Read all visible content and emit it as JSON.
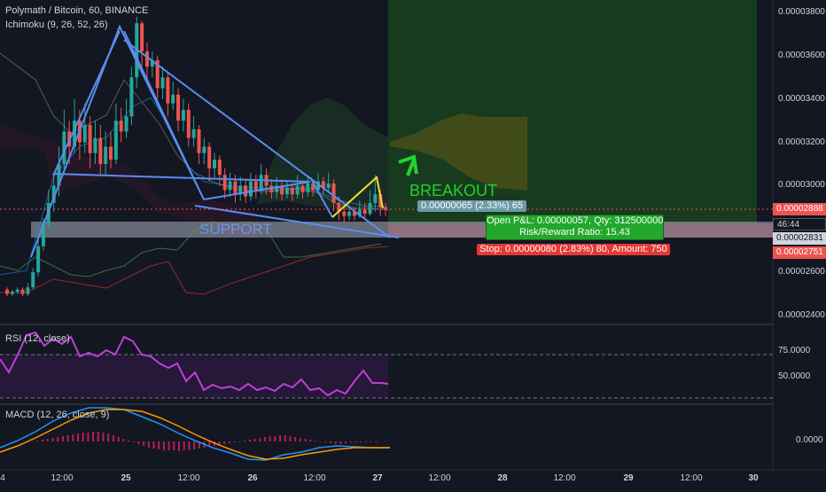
{
  "header": {
    "symbol_title": "Polymath / Bitcoin, 60, BINANCE",
    "indicator_ichimoku": "Ichimoku (9, 26, 52, 26)",
    "indicator_rsi": "RSI (12, close)",
    "indicator_macd": "MACD (12, 26, close, 9)"
  },
  "price_axis": {
    "ticks": [
      "0.00003800",
      "0.00003600",
      "0.00003400",
      "0.00003200",
      "0.00003000",
      "0.00002600",
      "0.00002400"
    ],
    "tick_values": [
      3.8e-05,
      3.6e-05,
      3.4e-05,
      3.2e-05,
      3e-05,
      2.6e-05,
      2.4e-05
    ],
    "current_price": "0.00002888",
    "countdown": "46:44",
    "entry_price": "0.00002831",
    "stop_price": "0.00002751"
  },
  "rsi_axis": {
    "ticks": [
      "75.0000",
      "50.0000"
    ],
    "tick_values": [
      75,
      50
    ],
    "upper_band": 70,
    "lower_band": 30
  },
  "macd_axis": {
    "ticks": [
      "0.0000"
    ],
    "tick_values": [
      0
    ]
  },
  "time_axis": {
    "labels": [
      "4",
      "12:00",
      "25",
      "12:00",
      "26",
      "12:00",
      "27",
      "12:00",
      "28",
      "12:00",
      "29",
      "12:00",
      "30"
    ],
    "bold_labels": [
      "25",
      "26",
      "27",
      "28",
      "29",
      "30"
    ]
  },
  "annotations": {
    "support": "SUPPORT",
    "breakout": "BREAKOUT",
    "target_box": "0.00000065 (2.33%) 65",
    "pnl_line1": "Open P&L: 0.00000057, Qty: 312500000",
    "pnl_line2": "Risk/Reward Ratio: 15.43",
    "stop_box": "Stop: 0.00000080 (2.83%) 80, Amount: 750"
  },
  "colors": {
    "background": "#131722",
    "up_candle": "#26a69a",
    "down_candle": "#ef5350",
    "trend_lines": "#5b8def",
    "rsi_line": "#c03fd6",
    "macd_line": "#2196f3",
    "signal_line": "#ff9800",
    "profit_zone": "#1e5a1e",
    "stop_zone": "#7a2a33",
    "breakout_text": "#22d32e"
  },
  "chart_data": {
    "type": "candlestick",
    "price_ylim": [
      2.37e-05,
      3.88e-05
    ],
    "rsi_ylim": [
      20,
      90
    ],
    "candles": [
      [
        2.52,
        2.5,
        2.53,
        2.49
      ],
      [
        2.5,
        2.51,
        2.52,
        2.49
      ],
      [
        2.51,
        2.52,
        2.53,
        2.5
      ],
      [
        2.52,
        2.5,
        2.53,
        2.49
      ],
      [
        2.5,
        2.53,
        2.55,
        2.49
      ],
      [
        2.53,
        2.6,
        2.62,
        2.52
      ],
      [
        2.6,
        2.72,
        2.75,
        2.58
      ],
      [
        2.72,
        2.82,
        2.85,
        2.7
      ],
      [
        2.82,
        2.92,
        2.98,
        2.8
      ],
      [
        2.92,
        3.0,
        3.05,
        2.88
      ],
      [
        3.0,
        3.1,
        3.18,
        2.95
      ],
      [
        3.1,
        3.25,
        3.35,
        3.05
      ],
      [
        3.25,
        3.18,
        3.3,
        3.1
      ],
      [
        3.18,
        3.3,
        3.4,
        3.15
      ],
      [
        3.3,
        3.2,
        3.35,
        3.12
      ],
      [
        3.2,
        3.28,
        3.38,
        3.15
      ],
      [
        3.28,
        3.15,
        3.32,
        3.08
      ],
      [
        3.15,
        3.22,
        3.3,
        3.1
      ],
      [
        3.22,
        3.1,
        3.28,
        3.05
      ],
      [
        3.1,
        3.18,
        3.25,
        3.05
      ],
      [
        3.18,
        3.12,
        3.25,
        3.08
      ],
      [
        3.12,
        3.3,
        3.38,
        3.1
      ],
      [
        3.3,
        3.25,
        3.36,
        3.2
      ],
      [
        3.25,
        3.32,
        3.4,
        3.22
      ],
      [
        3.32,
        3.5,
        3.55,
        3.28
      ],
      [
        3.5,
        3.75,
        3.78,
        3.45
      ],
      [
        3.75,
        3.62,
        3.76,
        3.55
      ],
      [
        3.62,
        3.55,
        3.66,
        3.48
      ],
      [
        3.55,
        3.58,
        3.62,
        3.5
      ],
      [
        3.58,
        3.45,
        3.6,
        3.4
      ],
      [
        3.45,
        3.5,
        3.55,
        3.4
      ],
      [
        3.5,
        3.38,
        3.52,
        3.32
      ],
      [
        3.38,
        3.42,
        3.48,
        3.35
      ],
      [
        3.42,
        3.3,
        3.45,
        3.25
      ],
      [
        3.3,
        3.35,
        3.4,
        3.25
      ],
      [
        3.35,
        3.22,
        3.38,
        3.18
      ],
      [
        3.22,
        3.26,
        3.32,
        3.18
      ],
      [
        3.26,
        3.15,
        3.28,
        3.1
      ],
      [
        3.15,
        3.18,
        3.22,
        3.1
      ],
      [
        3.18,
        3.08,
        3.2,
        3.02
      ],
      [
        3.08,
        3.12,
        3.15,
        3.03
      ],
      [
        3.12,
        3.05,
        3.14,
        3.0
      ],
      [
        3.05,
        2.98,
        3.08,
        2.94
      ],
      [
        2.98,
        3.02,
        3.06,
        2.95
      ],
      [
        3.02,
        2.96,
        3.05,
        2.92
      ],
      [
        2.96,
        3.0,
        3.04,
        2.93
      ],
      [
        3.0,
        2.95,
        3.03,
        2.92
      ],
      [
        2.95,
        3.02,
        3.06,
        2.93
      ],
      [
        3.02,
        2.98,
        3.05,
        2.94
      ],
      [
        2.98,
        3.05,
        3.1,
        2.96
      ],
      [
        3.05,
        3.0,
        3.08,
        2.96
      ],
      [
        3.0,
        2.97,
        3.03,
        2.94
      ],
      [
        2.97,
        3.0,
        3.04,
        2.94
      ],
      [
        3.0,
        2.96,
        3.02,
        2.93
      ],
      [
        2.96,
        2.99,
        3.02,
        2.94
      ],
      [
        2.99,
        2.96,
        3.01,
        2.93
      ],
      [
        2.96,
        3.0,
        3.05,
        2.94
      ],
      [
        3.0,
        2.97,
        3.02,
        2.94
      ],
      [
        2.97,
        3.01,
        3.04,
        2.95
      ],
      [
        3.01,
        2.98,
        3.03,
        2.95
      ],
      [
        2.98,
        3.02,
        3.06,
        2.96
      ],
      [
        3.02,
        2.99,
        3.04,
        2.96
      ],
      [
        2.99,
        3.01,
        3.06,
        2.97
      ],
      [
        3.01,
        2.92,
        3.03,
        2.88
      ],
      [
        2.92,
        2.88,
        2.95,
        2.84
      ],
      [
        2.88,
        2.86,
        2.91,
        2.83
      ],
      [
        2.86,
        2.88,
        2.91,
        2.84
      ],
      [
        2.88,
        2.86,
        2.9,
        2.84
      ],
      [
        2.86,
        2.89,
        2.93,
        2.85
      ],
      [
        2.89,
        2.87,
        2.92,
        2.85
      ],
      [
        2.87,
        2.92,
        2.98,
        2.86
      ],
      [
        2.92,
        2.96,
        3.05,
        2.88
      ],
      [
        2.96,
        2.9,
        2.98,
        2.86
      ],
      [
        2.9,
        2.89,
        2.92,
        2.86
      ]
    ]
  }
}
